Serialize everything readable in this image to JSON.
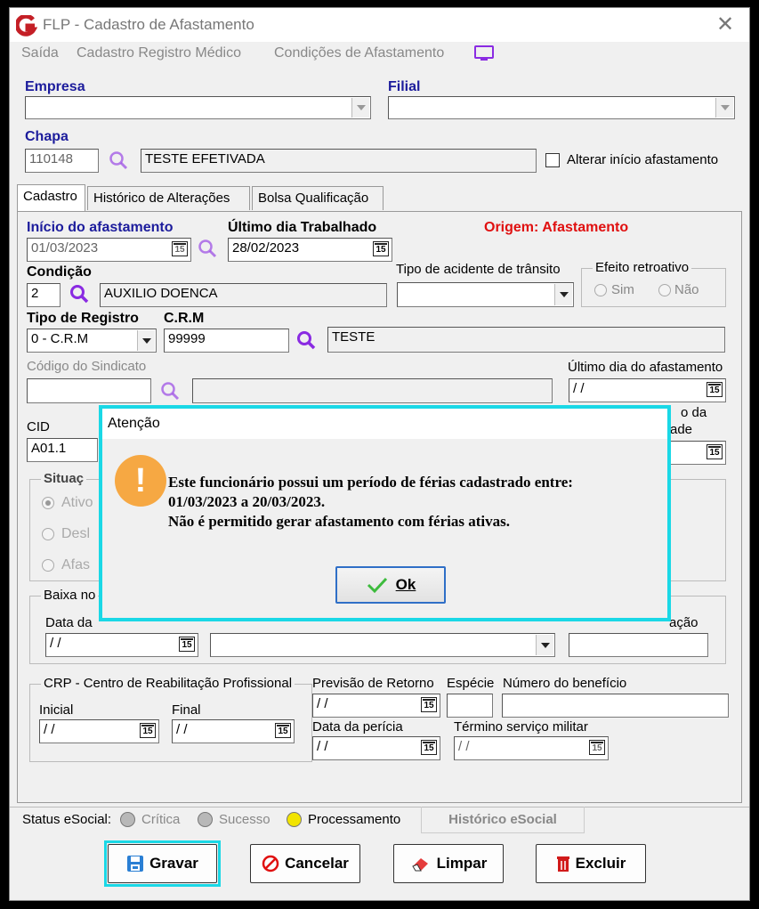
{
  "window": {
    "title": "FLP - Cadastro de Afastamento",
    "close": "✕"
  },
  "menu": [
    "Saída",
    "Cadastro Registro Médico",
    "Condições de Afastamento"
  ],
  "empresa": {
    "label": "Empresa",
    "value": ""
  },
  "filial": {
    "label": "Filial",
    "value": ""
  },
  "chapa": {
    "label": "Chapa",
    "value": "110148",
    "name": "TESTE EFETIVADA"
  },
  "alterar_inicio": {
    "label": "Alterar início afastamento",
    "checked": false
  },
  "tabs": [
    "Cadastro",
    "Histórico de Alterações",
    "Bolsa Qualificação"
  ],
  "inicio": {
    "label": "Início do afastamento",
    "value": "01/03/2023"
  },
  "ultimo_trab": {
    "label": "Último dia Trabalhado",
    "value": "28/02/2023"
  },
  "origem": "Origem: Afastamento",
  "condicao": {
    "label": "Condição",
    "code": "2",
    "desc": "AUXILIO DOENCA"
  },
  "tipo_acidente": {
    "label": "Tipo de acidente de trânsito",
    "value": ""
  },
  "efeito": {
    "label": "Efeito retroativo",
    "sim": "Sim",
    "nao": "Não"
  },
  "tipo_registro": {
    "label": "Tipo de Registro",
    "value": "0 - C.R.M"
  },
  "crm": {
    "label": "C.R.M",
    "value": "99999",
    "desc": "TESTE"
  },
  "sindicato": {
    "label": "Código do Sindicato",
    "value": ""
  },
  "ultimo_afast": {
    "label": "Último dia do afastamento",
    "value": "/ /"
  },
  "partial_labels": {
    "da": "o da",
    "ade": "ade",
    "situacao": "Situaç",
    "ativo": "Ativo",
    "desl": "Desl",
    "afas": "Afas",
    "baixa": "Baixa no",
    "data_baixa": "Data da",
    "acao": "ação"
  },
  "cid": {
    "label": "CID",
    "value": "A01.1"
  },
  "baixa_data": "/ /",
  "crp": {
    "label": "CRP - Centro de Reabilitação Profissional",
    "inicial_label": "Inicial",
    "final_label": "Final",
    "inicial": "/ /",
    "final": "/ /"
  },
  "previsao": {
    "label": "Previsão de Retorno",
    "value": "/ /"
  },
  "especie": {
    "label": "Espécie",
    "value": ""
  },
  "num_beneficio": {
    "label": "Número do benefício",
    "value": ""
  },
  "data_pericia": {
    "label": "Data da perícia",
    "value": "/ /"
  },
  "termino_militar": {
    "label": "Término serviço militar",
    "value": "/ /"
  },
  "calendar_icon_text": "15",
  "status": {
    "label": "Status eSocial:",
    "critica": "Crítica",
    "sucesso": "Sucesso",
    "processamento": "Processamento",
    "historico": "Histórico eSocial",
    "colors": {
      "critica": "#b8b8b8",
      "sucesso": "#b8b8b8",
      "processamento": "#f2e400"
    }
  },
  "buttons": {
    "gravar": "Gravar",
    "cancelar": "Cancelar",
    "limpar": "Limpar",
    "excluir": "Excluir"
  },
  "dialog": {
    "title": "Atenção",
    "icon": "!",
    "line1": "Este funcionário possui um período de férias cadastrado entre:",
    "line2": "01/03/2023 a 20/03/2023.",
    "line3": "Não é permitido gerar afastamento com férias ativas.",
    "ok": "Ok"
  },
  "colors": {
    "accent": "#1ad8e6",
    "brand": "#c41f26",
    "search": "#8a2be2"
  }
}
